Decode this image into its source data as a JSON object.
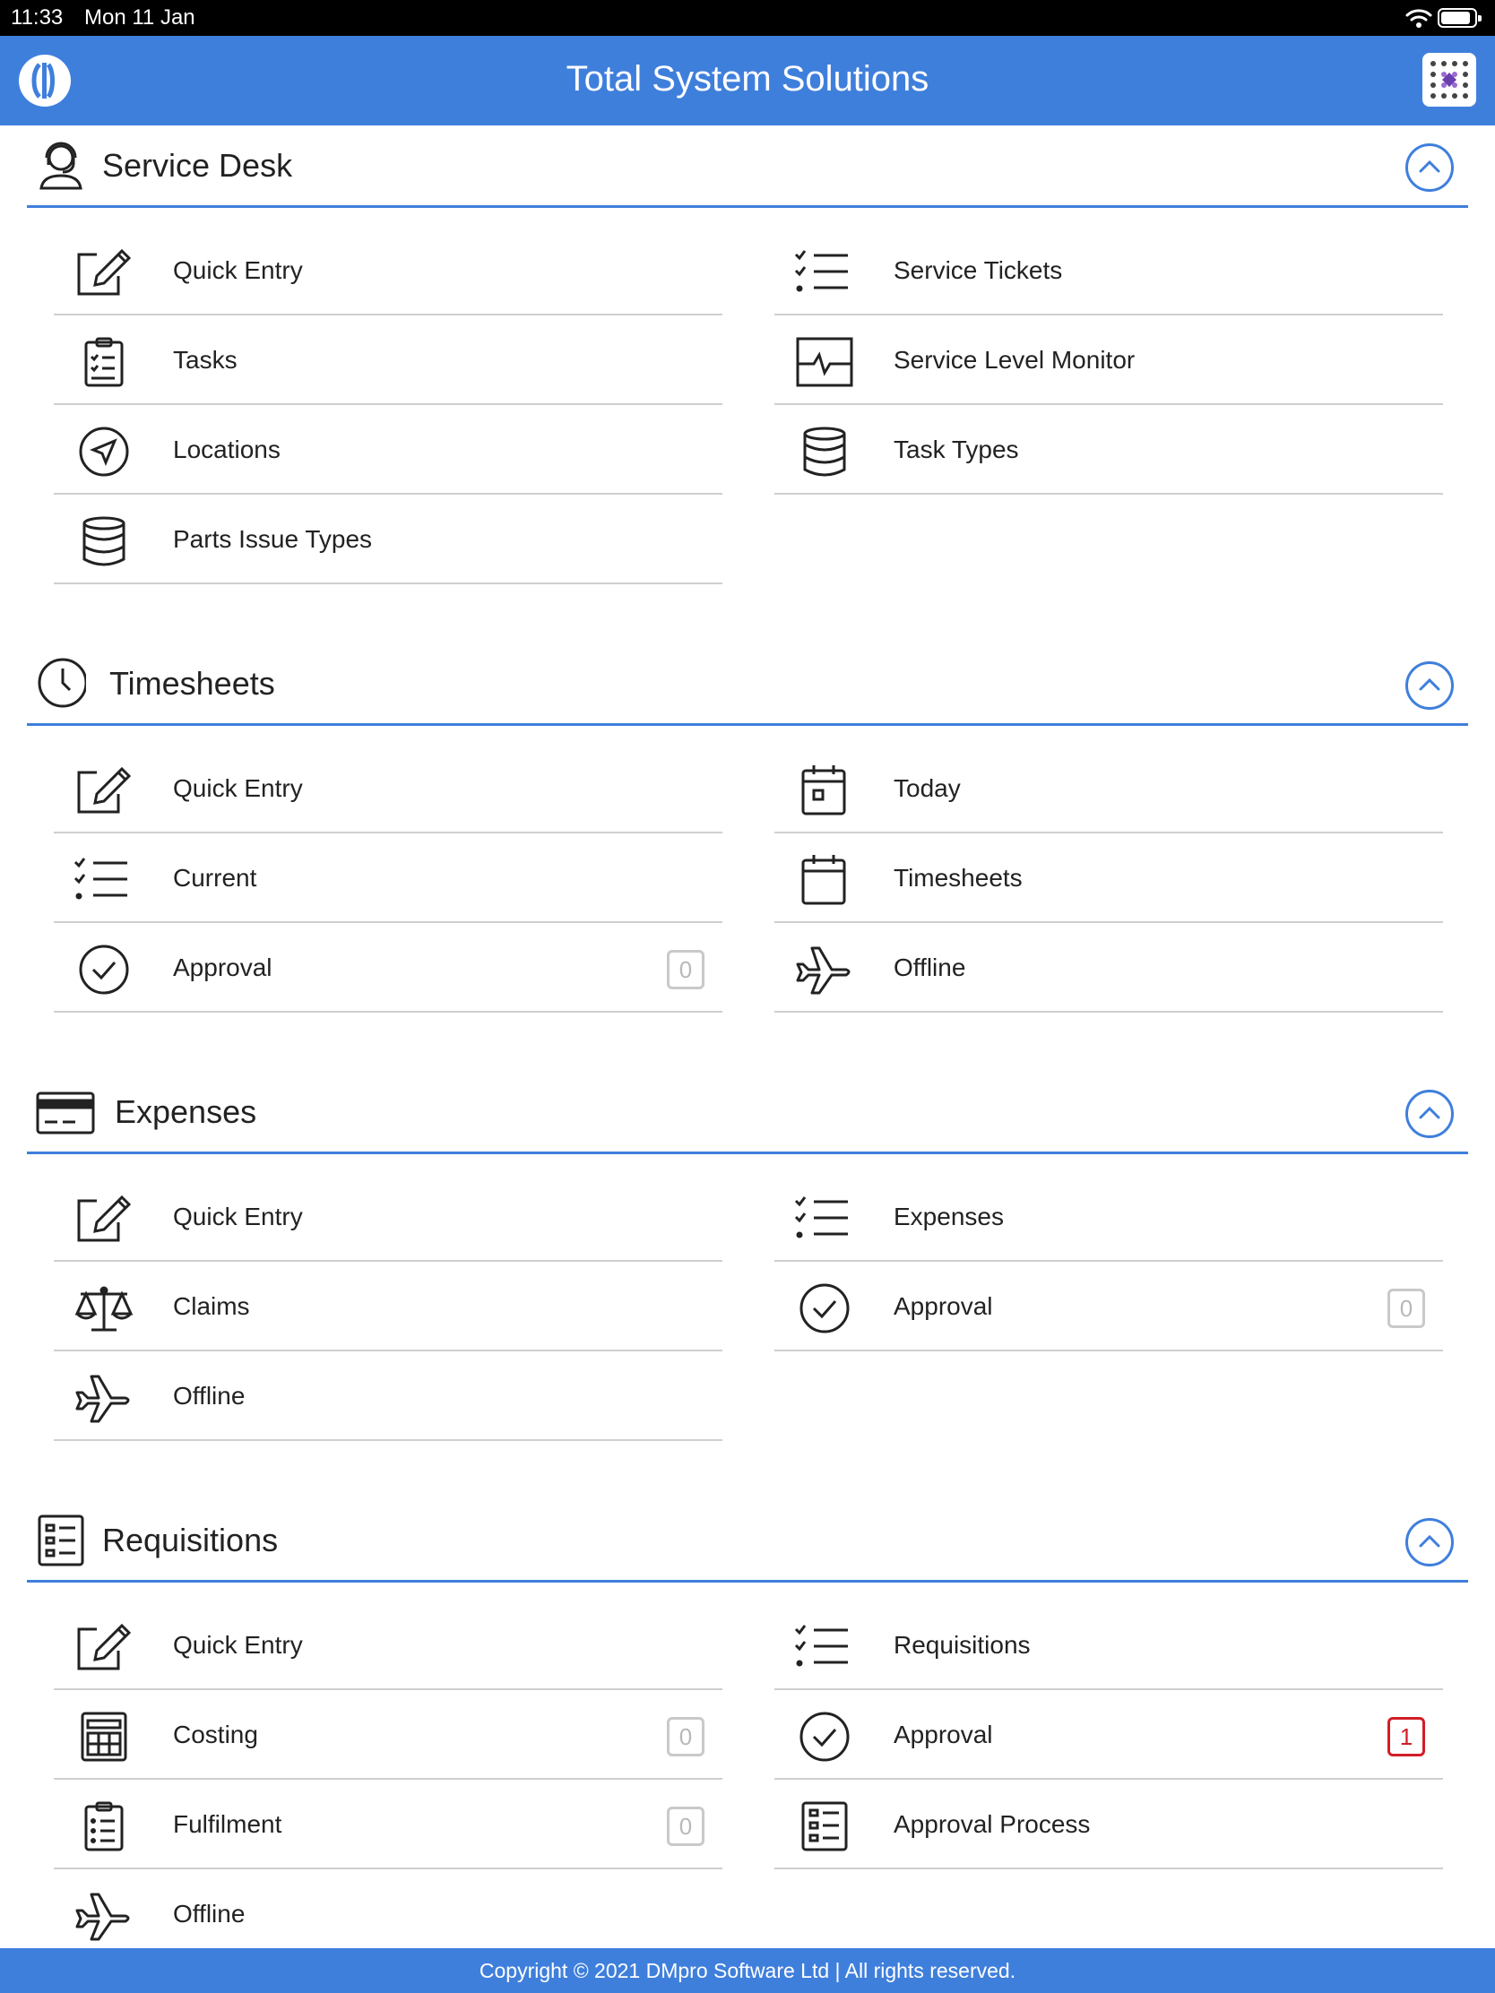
{
  "status_bar": {
    "time": "11:33",
    "date": "Mon 11 Jan"
  },
  "header": {
    "title": "Total System Solutions"
  },
  "sections": [
    {
      "title": "Service Desk",
      "items": [
        {
          "label": "Quick Entry"
        },
        {
          "label": "Service Tickets"
        },
        {
          "label": "Tasks"
        },
        {
          "label": "Service Level Monitor"
        },
        {
          "label": "Locations"
        },
        {
          "label": "Task Types"
        },
        {
          "label": "Parts Issue Types"
        }
      ]
    },
    {
      "title": "Timesheets",
      "items": [
        {
          "label": "Quick Entry"
        },
        {
          "label": "Today"
        },
        {
          "label": "Current"
        },
        {
          "label": "Timesheets"
        },
        {
          "label": "Approval",
          "badge": "0"
        },
        {
          "label": "Offline"
        }
      ]
    },
    {
      "title": "Expenses",
      "items": [
        {
          "label": "Quick Entry"
        },
        {
          "label": "Expenses"
        },
        {
          "label": "Claims"
        },
        {
          "label": "Approval",
          "badge": "0"
        },
        {
          "label": "Offline"
        }
      ]
    },
    {
      "title": "Requisitions",
      "items": [
        {
          "label": "Quick Entry"
        },
        {
          "label": "Requisitions"
        },
        {
          "label": "Costing",
          "badge": "0"
        },
        {
          "label": "Approval",
          "badge": "1"
        },
        {
          "label": "Fulfilment",
          "badge": "0"
        },
        {
          "label": "Approval Process"
        },
        {
          "label": "Offline"
        }
      ]
    }
  ],
  "footer": {
    "text": "Copyright © 2021 DMpro Software Ltd | All rights reserved."
  },
  "colors": {
    "accent": "#3f7fdc",
    "badge_alert": "#d21e26",
    "badge_neutral": "#c9c9c9"
  }
}
